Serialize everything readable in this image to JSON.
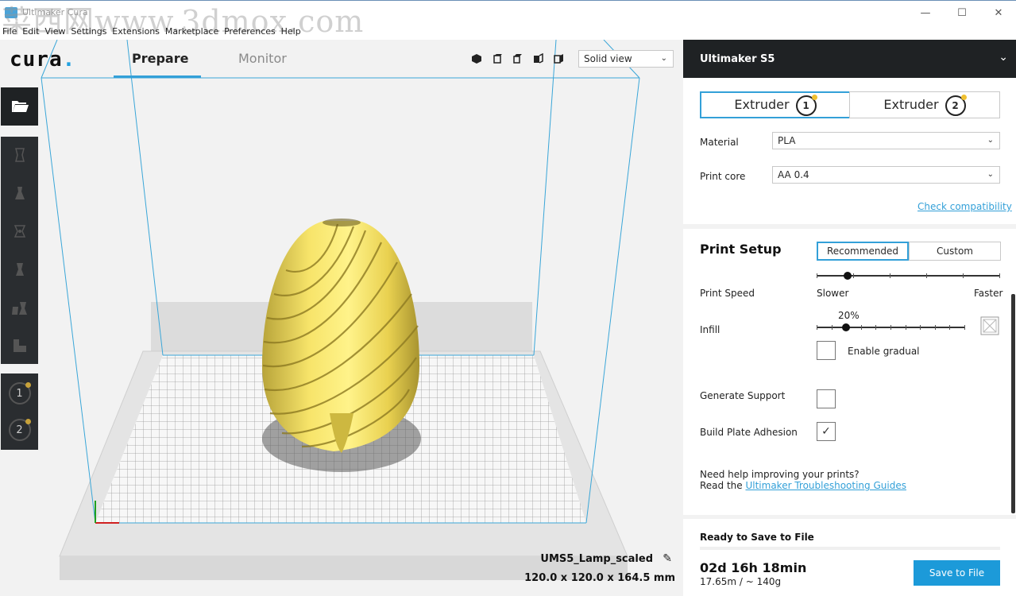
{
  "window": {
    "title": "Ultimaker Cura",
    "watermark": "菜西网www.3dmox.com",
    "minimize_icon": "minimize-icon",
    "maximize_icon": "maximize-icon",
    "close_icon": "close-icon"
  },
  "menu": [
    "File",
    "Edit",
    "View",
    "Settings",
    "Extensions",
    "Marketplace",
    "Preferences",
    "Help"
  ],
  "topbar": {
    "logo": "cura",
    "tabs": [
      {
        "label": "Prepare",
        "active": true
      },
      {
        "label": "Monitor",
        "active": false
      }
    ],
    "view_mode": "Solid view"
  },
  "object": {
    "name": "UMS5_Lamp_scaled",
    "dimensions": "120.0 x 120.0 x 164.5 mm"
  },
  "left_toolbar": {
    "extruder_buttons": [
      "1",
      "2"
    ]
  },
  "printer": {
    "name": "Ultimaker S5",
    "extruders": [
      {
        "label": "Extruder",
        "number": "1",
        "active": true
      },
      {
        "label": "Extruder",
        "number": "2",
        "active": false
      }
    ],
    "material_label": "Material",
    "material_value": "PLA",
    "core_label": "Print core",
    "core_value": "AA 0.4",
    "check_link": "Check compatibility"
  },
  "print_setup": {
    "title": "Print Setup",
    "modes": [
      {
        "label": "Recommended",
        "active": true
      },
      {
        "label": "Custom",
        "active": false
      }
    ],
    "speed_label": "Print Speed",
    "speed_min": "Slower",
    "speed_max": "Faster",
    "speed_position": 0.17,
    "infill_label": "Infill",
    "infill_value": "20%",
    "infill_fraction": 0.2,
    "gradual_label": "Enable gradual",
    "gradual_checked": false,
    "support_label": "Generate Support",
    "support_checked": false,
    "adhesion_label": "Build Plate Adhesion",
    "adhesion_checked": true,
    "help_line1": "Need help improving your prints?",
    "help_prefix": "Read the ",
    "help_link": "Ultimaker Troubleshooting Guides"
  },
  "save": {
    "status": "Ready to Save to File",
    "time": "02d 16h 18min",
    "material": "17.65m / ~ 140g",
    "button": "Save to File"
  },
  "colors": {
    "accent": "#33a0d8",
    "dark": "#1f2224",
    "model": "#f5e05a",
    "button": "#1c9ad9"
  }
}
